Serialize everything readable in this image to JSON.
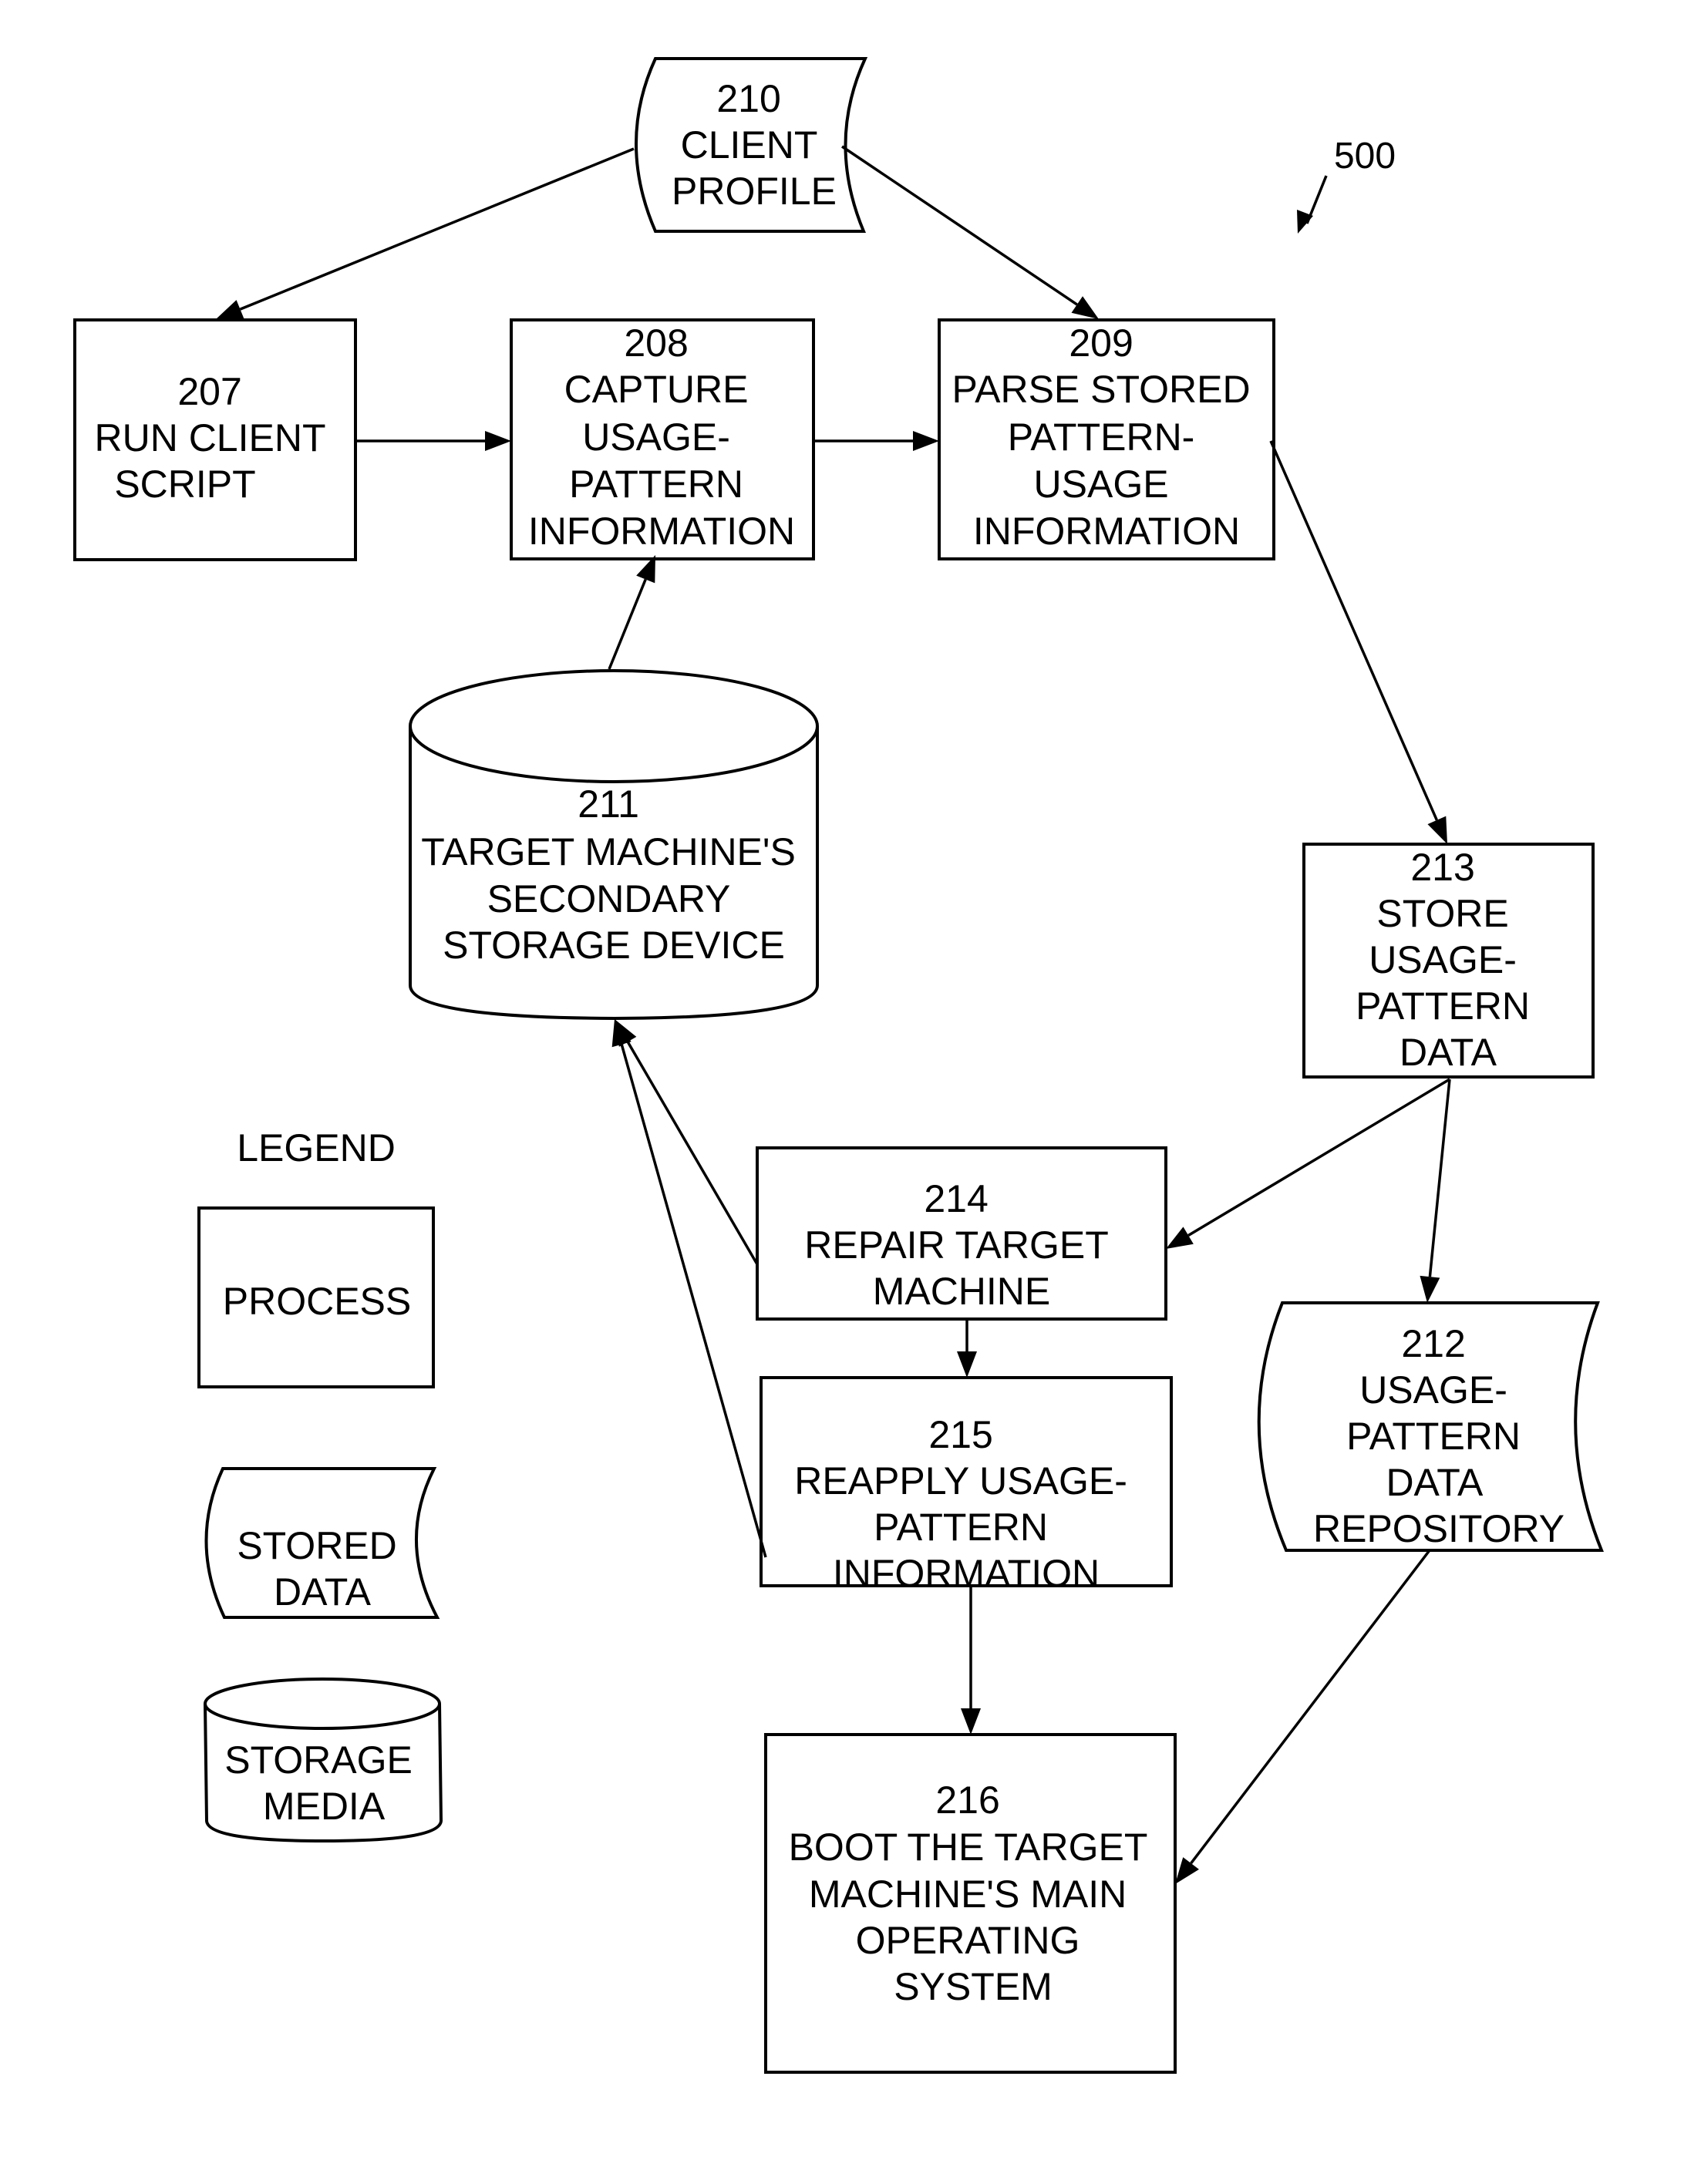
{
  "figure": {
    "reference_number": "500",
    "legend_title": "LEGEND"
  },
  "nodes": {
    "n207": {
      "id": "207",
      "type": "process",
      "lines": [
        "207",
        "RUN CLIENT",
        "SCRIPT"
      ]
    },
    "n208": {
      "id": "208",
      "type": "process",
      "lines": [
        "208",
        "CAPTURE",
        "USAGE-",
        "PATTERN",
        "INFORMATION"
      ]
    },
    "n209": {
      "id": "209",
      "type": "process",
      "lines": [
        "209",
        "PARSE STORED",
        "PATTERN-",
        "USAGE",
        "INFORMATION"
      ]
    },
    "n210": {
      "id": "210",
      "type": "stored-data",
      "lines": [
        "210",
        "CLIENT",
        "PROFILE"
      ]
    },
    "n211": {
      "id": "211",
      "type": "storage-media",
      "lines": [
        "211",
        "TARGET MACHINE'S",
        "SECONDARY",
        "STORAGE DEVICE"
      ]
    },
    "n212": {
      "id": "212",
      "type": "stored-data",
      "lines": [
        "212",
        "USAGE-",
        "PATTERN",
        "DATA",
        "REPOSITORY"
      ]
    },
    "n213": {
      "id": "213",
      "type": "process",
      "lines": [
        "213",
        "STORE",
        "USAGE-",
        "PATTERN",
        "DATA"
      ]
    },
    "n214": {
      "id": "214",
      "type": "process",
      "lines": [
        "214",
        "REPAIR TARGET",
        "MACHINE"
      ]
    },
    "n215": {
      "id": "215",
      "type": "process",
      "lines": [
        "215",
        "REAPPLY USAGE-",
        "PATTERN",
        "INFORMATION"
      ]
    },
    "n216": {
      "id": "216",
      "type": "process",
      "lines": [
        "216",
        "BOOT THE TARGET",
        "MACHINE'S MAIN",
        "OPERATING",
        "SYSTEM"
      ]
    }
  },
  "legend": {
    "process": {
      "lines": [
        "PROCESS"
      ]
    },
    "stored_data": {
      "lines": [
        "STORED",
        "DATA"
      ]
    },
    "storage_media": {
      "lines": [
        "STORAGE",
        "MEDIA"
      ]
    }
  },
  "edges": [
    {
      "from": "210",
      "to": "207"
    },
    {
      "from": "210",
      "to": "209"
    },
    {
      "from": "207",
      "to": "208"
    },
    {
      "from": "208",
      "to": "209"
    },
    {
      "from": "211",
      "to": "208"
    },
    {
      "from": "209",
      "to": "213"
    },
    {
      "from": "213",
      "to": "214"
    },
    {
      "from": "213",
      "to": "212"
    },
    {
      "from": "214",
      "to": "211"
    },
    {
      "from": "215",
      "to": "211"
    },
    {
      "from": "214",
      "to": "215"
    },
    {
      "from": "215",
      "to": "216"
    },
    {
      "from": "212",
      "to": "216"
    }
  ]
}
